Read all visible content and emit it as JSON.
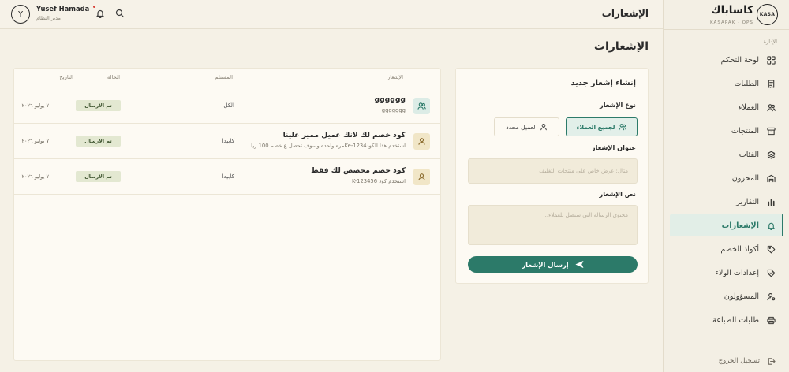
{
  "brand": {
    "logo_text": "KASA",
    "name": "كاساباك",
    "tagline": "KASAPAK · OPS"
  },
  "header": {
    "title": "الإشعارات",
    "user_name": "Yusef Hamada",
    "user_role": "مدير النظام",
    "avatar_initial": "Y",
    "has_unread": true
  },
  "sidebar": {
    "section_label": "الإدارة",
    "items": [
      {
        "label": "لوحة التحكم",
        "icon": "grid-icon"
      },
      {
        "label": "الطلبات",
        "icon": "receipt-icon"
      },
      {
        "label": "العملاء",
        "icon": "users-icon"
      },
      {
        "label": "المنتجات",
        "icon": "archive-icon"
      },
      {
        "label": "الفئات",
        "icon": "layers-icon"
      },
      {
        "label": "المخزون",
        "icon": "warehouse-icon"
      },
      {
        "label": "التقارير",
        "icon": "bar-chart-icon"
      },
      {
        "label": "الإشعارات",
        "icon": "bell-icon",
        "active": true
      },
      {
        "label": "أكواد الخصم",
        "icon": "tag-icon"
      },
      {
        "label": "إعدادات الولاء",
        "icon": "loyalty-tag-icon"
      },
      {
        "label": "المسؤولون",
        "icon": "user-gear-icon"
      },
      {
        "label": "طلبات الطباعة",
        "icon": "printer-icon"
      }
    ],
    "logout_label": "تسجيل الخروج"
  },
  "page": {
    "title": "الإشعارات"
  },
  "table": {
    "columns": {
      "notification": "الإشعار",
      "recipient": "المستلم",
      "status": "الحالة",
      "date": "التاريخ"
    },
    "rows": [
      {
        "icon": "users-icon",
        "title": "gggggg",
        "body": "ggggggg",
        "recipient": "الكل",
        "status": "تم الارسال",
        "date": "٧ يوليو ٢٠٢٦"
      },
      {
        "icon": "user-icon",
        "title": "كود خصم لك لانك عميل مميز علينا",
        "body": "استخدم هذا الكودKe-1234مره واحده وسوف تحصل ع خصم 100 ريا...",
        "recipient": "كابيدا",
        "status": "تم الارسال",
        "date": "٧ يوليو ٢٠٢٦"
      },
      {
        "icon": "user-icon",
        "title": "كود خصم مخصص لك فقط",
        "body": "استخدم كود K-123456",
        "recipient": "كابيدا",
        "status": "تم الارسال",
        "date": "٧ يوليو ٢٠٢٦"
      }
    ]
  },
  "form": {
    "title": "إنشاء إشعار جديد",
    "type_label": "نوع الإشعار",
    "type_options": [
      {
        "label": "لجميع العملاء",
        "icon": "users-icon",
        "selected": true
      },
      {
        "label": "لعميل محدد",
        "icon": "user-icon",
        "selected": false
      }
    ],
    "title_label": "عنوان الإشعار",
    "title_value": "",
    "title_placeholder": "مثال: عرض خاص على منتجات التغليف",
    "body_label": "نص الإشعار",
    "body_value": "",
    "body_placeholder": "محتوى الرسالة التي ستصل للعملاء...",
    "submit_label": "إرسال الإشعار",
    "submit_icon": "send-icon"
  },
  "colors": {
    "primary": "#2c7a69",
    "active_bg": "#e2eee7",
    "badge_bg": "#e3e8d1",
    "badge_text": "#3f5530",
    "notification_dot": "#d8443a",
    "background": "#f5f1e6",
    "card": "#fdfaf3"
  }
}
